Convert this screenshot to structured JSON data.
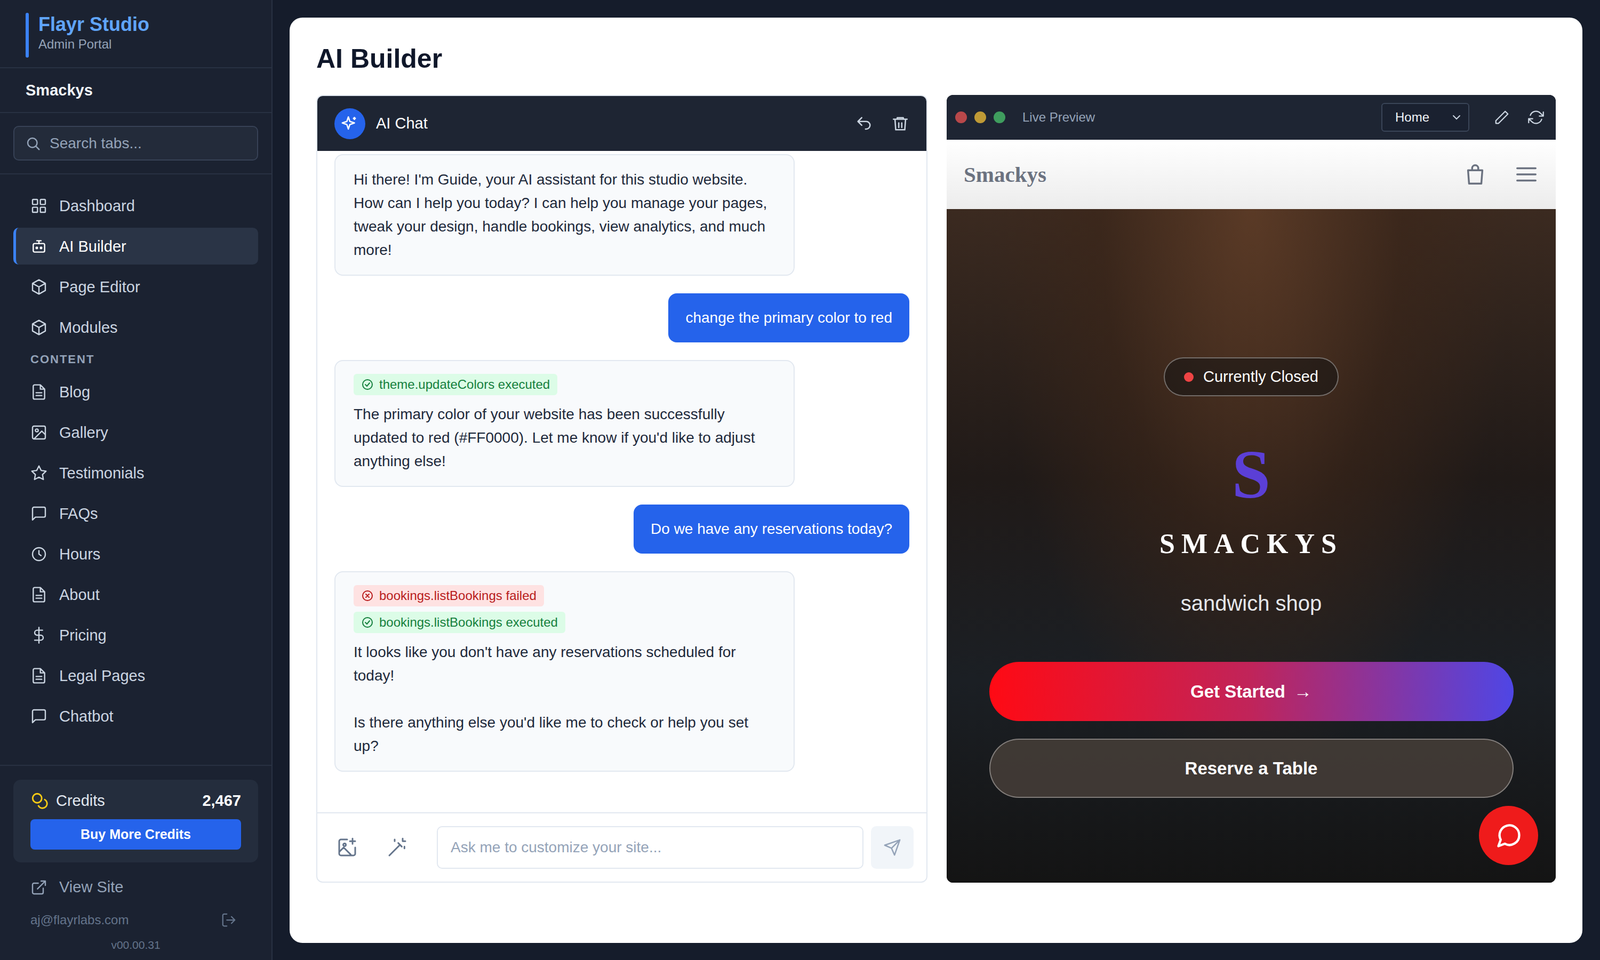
{
  "sidebar": {
    "brand": {
      "title": "Flayr Studio",
      "subtitle": "Admin Portal"
    },
    "site": "Smackys",
    "search": {
      "placeholder": "Search tabs..."
    },
    "nav": [
      {
        "label": "Dashboard",
        "kind": "grid",
        "selected": false
      },
      {
        "label": "AI Builder",
        "kind": "bot",
        "selected": true
      },
      {
        "label": "Page Editor",
        "kind": "cube",
        "selected": false
      },
      {
        "label": "Modules",
        "kind": "cube",
        "selected": false
      }
    ],
    "content_heading": "CONTENT",
    "content_items": [
      {
        "label": "Blog",
        "kind": "doc",
        "selected": false
      },
      {
        "label": "Gallery",
        "kind": "image",
        "selected": false
      },
      {
        "label": "Testimonials",
        "kind": "star",
        "selected": false
      },
      {
        "label": "FAQs",
        "kind": "chat",
        "selected": false
      },
      {
        "label": "Hours",
        "kind": "clock",
        "selected": false
      },
      {
        "label": "About",
        "kind": "doc",
        "selected": false
      },
      {
        "label": "Pricing",
        "kind": "dollar",
        "selected": false
      },
      {
        "label": "Legal Pages",
        "kind": "doc",
        "selected": false
      },
      {
        "label": "Chatbot",
        "kind": "chat",
        "selected": false
      }
    ],
    "credits": {
      "label": "Credits",
      "value": "2,467",
      "button": "Buy More Credits"
    },
    "view_site": "View Site",
    "user_email": "aj@flayrlabs.com",
    "version": "v00.00.31"
  },
  "page": {
    "title": "AI Builder"
  },
  "chat": {
    "title": "AI Chat",
    "messages": [
      {
        "role": "assistant",
        "tools": [],
        "paragraphs": [
          "Hi there! I'm Guide, your AI assistant for this studio website. How can I help you today? I can help you manage your pages, tweak your design, handle bookings, view analytics, and much more!"
        ]
      },
      {
        "role": "user",
        "tools": [],
        "paragraphs": [
          "change the primary color to red"
        ]
      },
      {
        "role": "assistant",
        "tools": [
          {
            "label": "theme.updateColors executed",
            "ok": true
          }
        ],
        "paragraphs": [
          "The primary color of your website has been successfully updated to red (#FF0000). Let me know if you'd like to adjust anything else!"
        ]
      },
      {
        "role": "user",
        "tools": [],
        "paragraphs": [
          "Do we have any reservations today?"
        ]
      },
      {
        "role": "assistant",
        "tools": [
          {
            "label": "bookings.listBookings failed",
            "ok": false
          },
          {
            "label": "bookings.listBookings executed",
            "ok": true
          }
        ],
        "paragraphs": [
          "It looks like you don't have any reservations scheduled for today!",
          "Is there anything else you'd like me to check or help you set up?"
        ]
      }
    ],
    "input": {
      "placeholder": "Ask me to customize your site..."
    }
  },
  "preview": {
    "title": "Live Preview",
    "page_select": "Home",
    "site_name": "Smackys",
    "status": {
      "label": "Currently Closed",
      "open": false
    },
    "logo_letter": "S",
    "hero_title": "SMACKYS",
    "hero_subtitle": "sandwich shop",
    "buttons": [
      {
        "label": "Get Started",
        "arrow": "→",
        "kind": "primary"
      },
      {
        "label": "Reserve a Table",
        "arrow": "",
        "kind": "secondary"
      }
    ]
  }
}
